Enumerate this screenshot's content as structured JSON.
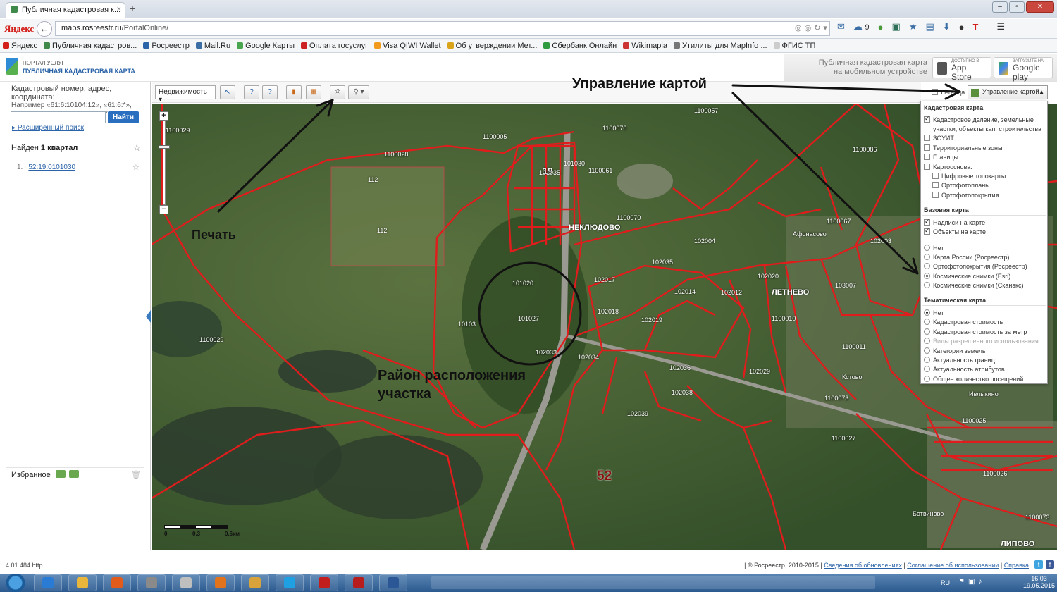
{
  "browser": {
    "tab_title": "Публичная кадастровая к...",
    "tab_close": "×",
    "new_tab": "+",
    "yandex_logo": "Яндекс",
    "back": "←",
    "url_host": "maps.rosreestr.ru",
    "url_path": "/PortalOnline/",
    "weather_count": "9",
    "bookmarks": [
      {
        "label": "Яндекс",
        "color": "#d4201b"
      },
      {
        "label": "Публичная кадастров...",
        "color": "#3f8a4a"
      },
      {
        "label": "Росреестр",
        "color": "#2a63a8"
      },
      {
        "label": "Mail.Ru",
        "color": "#3b6ea5"
      },
      {
        "label": "Google Карты",
        "color": "#4aa54f"
      },
      {
        "label": "Оплата госуслуг",
        "color": "#cc2222"
      },
      {
        "label": "Visa QIWI Wallet",
        "color": "#f29a1d"
      },
      {
        "label": "Об утверждении Мет...",
        "color": "#d9a41a"
      },
      {
        "label": "Сбербанк Онлайн",
        "color": "#2f9b3f"
      },
      {
        "label": "Wikimapia",
        "color": "#cc3333"
      },
      {
        "label": "Утилиты для MapInfo ...",
        "color": "#777777"
      },
      {
        "label": "ФГИС ТП",
        "color": "#cccccc"
      }
    ]
  },
  "site": {
    "title_small": "Портал услуг",
    "title_main": "Публичная кадастровая карта",
    "mobile_text": "Публичная кадастровая карта на мобильном устройстве",
    "appstore_small": "Доступно в",
    "appstore_label": "App Store",
    "gplay_small": "Загрузите на",
    "gplay_label": "Google play"
  },
  "search": {
    "hint_title": "Кадастровый номер, адрес, координата:",
    "hint_example": "Например «61:6:10104:12», «61:6:*», «Москва» или «55.755768, 37.617671»",
    "input_value": "",
    "button_label": "Найти",
    "advanced_label": "Расширенный поиск"
  },
  "results": {
    "found_prefix": "Найден",
    "found_count": "1 квартал",
    "items": [
      {
        "num": "1.",
        "label": "52:19:0101030"
      }
    ]
  },
  "favorites": {
    "label": "Избранное"
  },
  "toolbar": {
    "layer_select": "Недвижимость"
  },
  "map_control": {
    "legend_label": "Легенда",
    "button_label": "Управление картой",
    "cadastral_title": "Кадастровая карта",
    "cadastral_options": [
      {
        "label": "Кадастровое деление, земельные",
        "label2": "участки, объекты кап. строительства",
        "checked": true
      },
      {
        "label": "ЗОУИТ",
        "checked": false
      },
      {
        "label": "Территориальные зоны",
        "checked": false
      },
      {
        "label": "Границы",
        "checked": false
      },
      {
        "label": "Картооснова:",
        "checked": false
      }
    ],
    "base_sub_options": [
      {
        "label": "Цифровые топокарты"
      },
      {
        "label": "Ортофотопланы"
      },
      {
        "label": "Ортофотопокрытия"
      }
    ],
    "base_title": "Базовая карта",
    "base_checks": [
      {
        "label": "Надписи на карте",
        "checked": true
      },
      {
        "label": "Объекты на карте",
        "checked": true
      }
    ],
    "base_radios": [
      {
        "label": "Нет",
        "selected": false
      },
      {
        "label": "Карта России (Росреестр)",
        "selected": false
      },
      {
        "label": "Ортофотопокрытия (Росреестр)",
        "selected": false
      },
      {
        "label": "Космические снимки (Esri)",
        "selected": true
      },
      {
        "label": "Космические снимки (Сканэкс)",
        "selected": false
      }
    ],
    "thematic_title": "Тематическая карта",
    "thematic_radios": [
      {
        "label": "Нет",
        "selected": true,
        "disabled": false
      },
      {
        "label": "Кадастровая стоимость",
        "selected": false,
        "disabled": false
      },
      {
        "label": "Кадастровая стоимость за метр",
        "selected": false,
        "disabled": false
      },
      {
        "label": "Виды разрешенного использования",
        "selected": false,
        "disabled": true
      },
      {
        "label": "Категории земель",
        "selected": false,
        "disabled": false
      },
      {
        "label": "Актуальность границ",
        "selected": false,
        "disabled": false
      },
      {
        "label": "Актуальность атрибутов",
        "selected": false,
        "disabled": false
      },
      {
        "label": "Общее количество посещений",
        "selected": false,
        "disabled": false
      }
    ]
  },
  "map": {
    "places": [
      "НЕКЛЮДОВО",
      "ЛЕТНЕВО",
      "ЛИПОВО",
      "Афонасово",
      "Кстово",
      "Ивлыкино",
      "Ботвиново"
    ],
    "parcels": [
      "1100057",
      "1100029",
      "1100005",
      "1100028",
      "1100070",
      "1100061",
      "1100070",
      "101030",
      "19",
      "112",
      "112",
      "1100029",
      "101020",
      "101027",
      "10103",
      "102034",
      "102035",
      "102017",
      "102018",
      "102019",
      "102014",
      "102012",
      "102004",
      "102020",
      "1100067",
      "103007",
      "102029",
      "102036",
      "102038",
      "1100073",
      "1100027",
      "1100025",
      "1100026",
      "102039",
      "52",
      "1100086",
      "102003",
      "1100011",
      "1100010",
      "102033",
      "101035",
      "1100073"
    ],
    "scale_labels": [
      "0",
      "0.3",
      "0.6км"
    ]
  },
  "annotations": {
    "print": "Печать",
    "map_control": "Управление картой",
    "location_line1": "Район расположения",
    "location_line2": "участка"
  },
  "footer": {
    "version": "4.01.484.http",
    "copyright": "| © Росреестр, 2010-2015 |",
    "link_updates": "Сведения об обновлениях",
    "link_terms": "Соглашение об использовании",
    "link_help": "Справка"
  },
  "taskbar": {
    "lang": "RU",
    "time": "16:03",
    "date": "19.05.2015",
    "apps": [
      "#2a7bd4",
      "#e8b63a",
      "#e25b1b",
      "#8a8a8a",
      "#bfbfbf",
      "#e0731c",
      "#d7a33a",
      "#1fa0e3",
      "#c21e1e",
      "#b71d1d",
      "#2b5797"
    ]
  },
  "colors": {
    "parcel_line": "#e01c1c",
    "accent": "#2a63a8",
    "map_green": "#3f5a2e"
  }
}
